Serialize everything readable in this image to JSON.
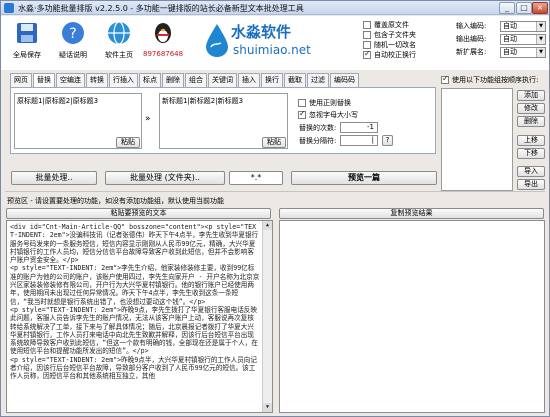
{
  "window": {
    "title": "水淼·多功能批量排版 v2.2.5.0 - 多功能一键排版的站长必备新型文本批处理工具",
    "min": "_",
    "max": "□",
    "close": "×"
  },
  "toolbar": {
    "save": "全局保存",
    "help": "疑话说明",
    "homepage": "软件主页",
    "qq": "897687648"
  },
  "brand": {
    "name": "水淼软件",
    "url": "shuimiao.net"
  },
  "options": [
    {
      "label": "覆盖原文件",
      "checked": false
    },
    {
      "label": "包含子文件夹",
      "checked": false
    },
    {
      "label": "随机一切改名",
      "checked": false
    },
    {
      "label": "自动校正换行",
      "checked": true
    }
  ],
  "encodings": [
    {
      "label": "输入编码:",
      "value": "自动"
    },
    {
      "label": "输出编码:",
      "value": "自动"
    },
    {
      "label": "新扩展名:",
      "value": "自动"
    }
  ],
  "tabs": [
    "网页",
    "替换",
    "空编连",
    "转换",
    "行插入",
    "标点",
    "删除",
    "组合",
    "关键词",
    "插入",
    "换行",
    "截取",
    "过滤",
    "编码码"
  ],
  "replace_panel": {
    "find": "原标题1|原标题2|原标题3",
    "replace": "新标题1|新标题2|新标题3",
    "paste": "粘贴",
    "use_regex": "使用正则替换",
    "ignore_case": "忽视字母大小写",
    "count_label": "替换的次数:",
    "count_value": "-1",
    "sep_label": "替换分隔符:",
    "sep_value": "|",
    "sep_help": "?"
  },
  "right": {
    "use_order": "使用以下功能组按顺序执行:",
    "add": "添加",
    "edit": "修改",
    "delete": "删除",
    "up": "上移",
    "down": "下移",
    "import": "导入",
    "export": "导出"
  },
  "actions": {
    "batch": "批量处理..",
    "batch_folder": "批量处理 (文件夹)..",
    "ext": "*.*",
    "preview_all": "预览一篇"
  },
  "hint": "预览区 - 请设置要处理的功能，如没有添加功能组，默认使用当前功能",
  "preview_left_title": "粘贴要预览的文本",
  "preview_right_title": "复制预览结果",
  "code_lines": [
    "<div id=\"Cnt-Main-Article-QQ\" bosszone=\"content\"><p style=\"TEXT-INDENT: 2em\">没骗科技讯（记者张德伟）昨天下午4点半，李先生收到华夏银行服务号码发来的一条服务短信，短信内容显示刚刚从人民币99亿元，精确，大兴华夏村镇银行的工作人员均，短信分信信平台故障导致客户收到此短信，但并不会影响客户账户资金安全。</p>",
    "<p style=\"TEXT-INDENT: 2em\">李先生介绍，他家装修装修主要，收到99亿标准的账户为他的公司的账户，该账户使用四过，李先生向家开户 - 开户名称为北京京兴区家装装修装修有限公司，开户行为大兴华夏村镇银行。他的银行账户已经使用两年，使用期间未出现过任何异常情况。昨天下午4点半，李先生收到这条一条短信，“我当时就想是银行系统出错了，也没想过要动这个钱”。</p>",
    "<p style=\"TEXT-INDENT: 2em\">昨晚9点，李先生拨打了华夏银行客服电话反映此问题，客服人员告诉李先生的账户情况，无法从该客户账户上动，客服说再次复核转给系统解决了工单，接下来与了解具体情况；随后，北京晨报记者拨打了华夏大兴华夏村镇银行，工作人员打来电话中向北先生致歉并解释，因该行后台短信平台出现系统故障导致客户收到此短信，“但这一个款有明确的钱，全部现在还是属于个人，在使用短信平台和提醒功能所发出的短信”。</p>",
    "<p style=\"TEXT-INDENT: 2em\">昨晚9点半，大兴华夏村镇银行的工作人员向记者介绍，因该行后台短信平台故障，导致部分客户收到了人民币99亿元的短信。该工作人员称，因短信平台和其他系统相互独立，其他"
  ]
}
